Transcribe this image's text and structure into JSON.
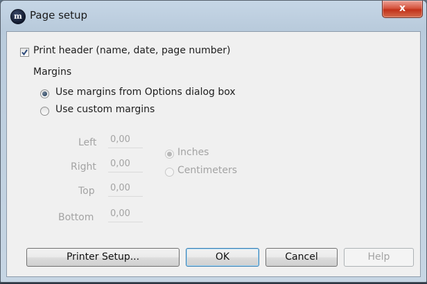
{
  "window": {
    "title": "Page setup",
    "close_label": "x",
    "app_icon_letter": "m"
  },
  "print_header": {
    "label": "Print header (name, date, page number)",
    "checked": true
  },
  "margins": {
    "group_label": "Margins",
    "options": [
      {
        "label": "Use margins from Options dialog box",
        "selected": true
      },
      {
        "label": "Use custom margins",
        "selected": false
      }
    ],
    "fields": [
      {
        "label": "Left",
        "value": "0,00"
      },
      {
        "label": "Right",
        "value": "0,00"
      },
      {
        "label": "Top",
        "value": "0,00"
      },
      {
        "label": "Bottom",
        "value": "0,00"
      }
    ],
    "units": [
      {
        "label": "Inches",
        "selected": true
      },
      {
        "label": "Centimeters",
        "selected": false
      }
    ]
  },
  "buttons": {
    "printer_setup": "Printer Setup...",
    "ok": "OK",
    "cancel": "Cancel",
    "help": "Help"
  }
}
